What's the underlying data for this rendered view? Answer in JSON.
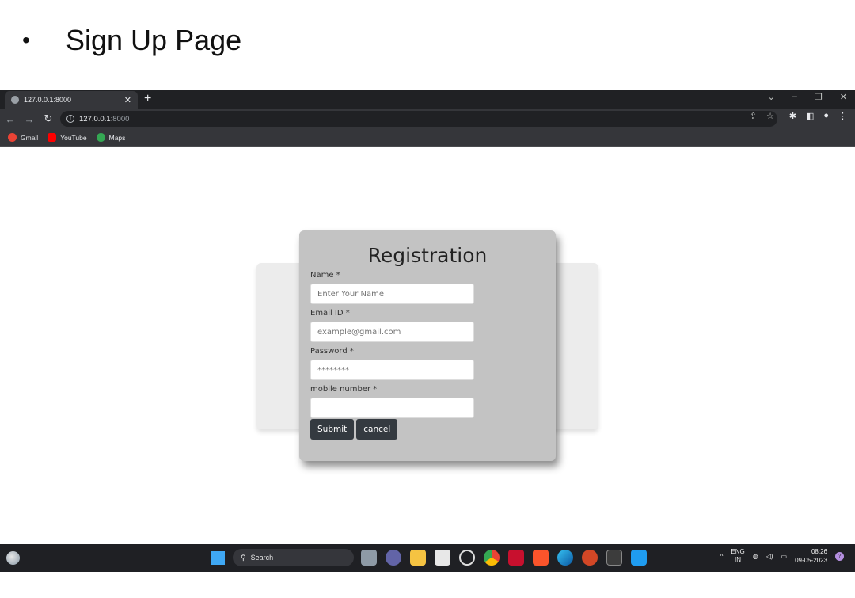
{
  "slide": {
    "bullet": "•",
    "title": "Sign Up Page"
  },
  "browser": {
    "tab_title": "127.0.0.1:8000",
    "tab_close": "✕",
    "new_tab": "+",
    "address_host": "127.0.0.1",
    "address_port": ":8000",
    "bookmarks": [
      {
        "label": "Gmail",
        "icon": "google-icon",
        "color": "#ea4335"
      },
      {
        "label": "YouTube",
        "icon": "youtube-icon",
        "color": "#ff0000"
      },
      {
        "label": "Maps",
        "icon": "maps-icon",
        "color": "#34a853"
      }
    ]
  },
  "form": {
    "heading": "Registration",
    "name_label": "Name *",
    "name_placeholder": "Enter Your Name",
    "email_label": "Email ID *",
    "email_placeholder": "example@gmail.com",
    "password_label": "Password *",
    "password_placeholder": "********",
    "mobile_label": "mobile number *",
    "submit_label": "Submit",
    "cancel_label": "cancel"
  },
  "taskbar": {
    "search_label": "Search",
    "lang_line1": "ENG",
    "lang_line2": "IN",
    "time": "08:26",
    "date": "09-05-2023"
  },
  "colors": {
    "card_bg": "#c3c3c3",
    "back_card_bg": "#ececec",
    "button_bg": "#343a40",
    "chrome_dark": "#202124",
    "taskbar_bg": "#1f2024"
  }
}
